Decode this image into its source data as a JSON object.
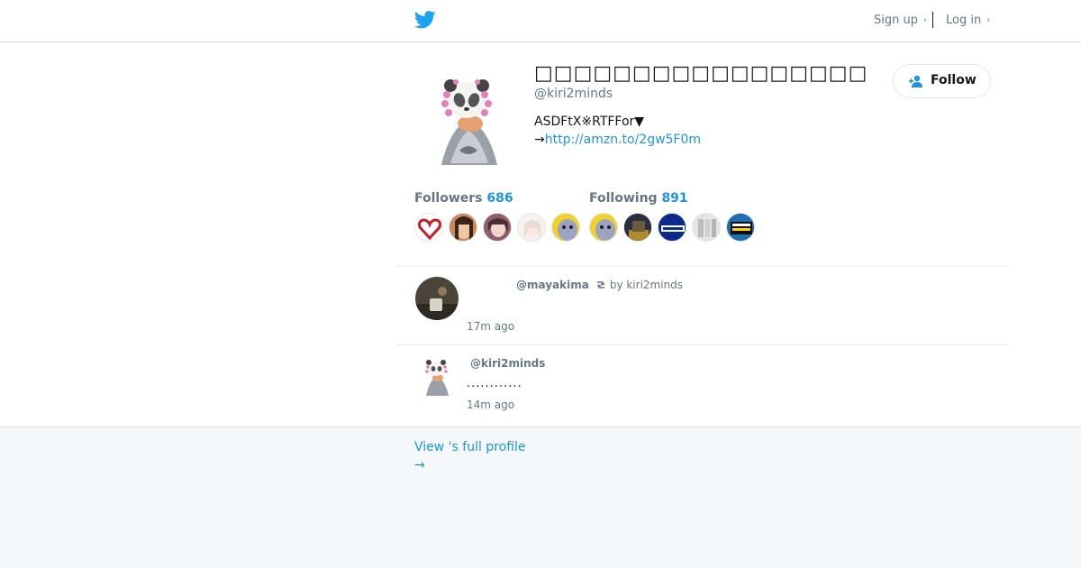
{
  "header": {
    "logo_icon": "twitter-bird-icon",
    "signup_label": "Sign up",
    "login_label": "Log in",
    "chevron": "›"
  },
  "profile": {
    "display_name": "□□□□□□□□□□□□□□□□□",
    "handle": "@kiri2minds",
    "bio_line1": "ASDFtX※RTFFor▼",
    "bio_arrow": "→",
    "bio_link": "http://amzn.to/2gw5F0m",
    "follow_label": "Follow",
    "followers_label": "Followers",
    "followers_count": "686",
    "following_label": "Following",
    "following_count": "891"
  },
  "tweets": [
    {
      "handle": "@mayakima",
      "retweet_by": "by kiri2minds",
      "text": "",
      "time": "17m ago"
    },
    {
      "handle": "@kiri2minds",
      "retweet_by": "",
      "text": "............",
      "time": "14m ago"
    }
  ],
  "footer": {
    "view_profile": "View 's full profile",
    "arrow": "→"
  },
  "colors": {
    "accent": "#1b95e0",
    "bird": "#1da1f2",
    "muted": "#657786"
  }
}
